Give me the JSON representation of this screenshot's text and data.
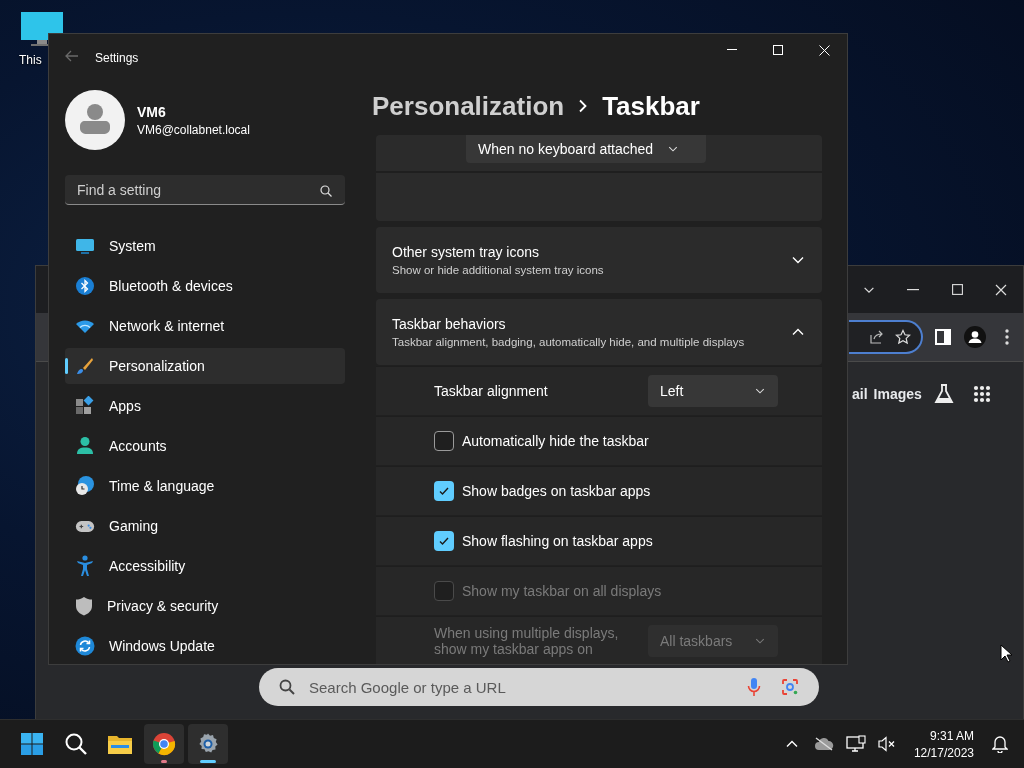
{
  "desktop": {
    "icons": [
      {
        "label": "This"
      }
    ]
  },
  "browser_window": {
    "links": [
      {
        "label": "ail"
      },
      {
        "label": "Images"
      }
    ],
    "search": {
      "placeholder": "Search Google or type a URL"
    }
  },
  "settings_window": {
    "title": "Settings",
    "profile": {
      "name": "VM6",
      "email": "VM6@collabnet.local"
    },
    "search": {
      "placeholder": "Find a setting"
    },
    "nav": [
      {
        "label": "System",
        "selected": false
      },
      {
        "label": "Bluetooth & devices",
        "selected": false
      },
      {
        "label": "Network & internet",
        "selected": false
      },
      {
        "label": "Personalization",
        "selected": true
      },
      {
        "label": "Apps",
        "selected": false
      },
      {
        "label": "Accounts",
        "selected": false
      },
      {
        "label": "Time & language",
        "selected": false
      },
      {
        "label": "Gaming",
        "selected": false
      },
      {
        "label": "Accessibility",
        "selected": false
      },
      {
        "label": "Privacy & security",
        "selected": false
      },
      {
        "label": "Windows Update",
        "selected": false
      }
    ],
    "breadcrumb": [
      "Personalization",
      "Taskbar"
    ],
    "partial_card": {
      "value": "When no keyboard attached"
    },
    "cards": [
      {
        "title": "Other system tray icons",
        "subtitle": "Show or hide additional system tray icons",
        "expanded": false
      },
      {
        "title": "Taskbar behaviors",
        "subtitle": "Taskbar alignment, badging, automatically hide, and multiple displays",
        "expanded": true,
        "rows": [
          {
            "kind": "select",
            "label": "Taskbar alignment",
            "value": "Left",
            "disabled": false
          },
          {
            "kind": "checkbox",
            "label": "Automatically hide the taskbar",
            "checked": false,
            "disabled": false
          },
          {
            "kind": "checkbox",
            "label": "Show badges on taskbar apps",
            "checked": true,
            "disabled": false
          },
          {
            "kind": "checkbox",
            "label": "Show flashing on taskbar apps",
            "checked": true,
            "disabled": false
          },
          {
            "kind": "checkbox",
            "label": "Show my taskbar on all displays",
            "checked": false,
            "disabled": true
          },
          {
            "kind": "select",
            "label": "When using multiple displays, show my taskbar apps on",
            "value": "All taskbars",
            "disabled": true
          }
        ]
      }
    ]
  },
  "taskbar": {
    "apps": [
      {
        "kind": "start",
        "running": false,
        "focused": false
      },
      {
        "kind": "search",
        "running": false,
        "focused": false
      },
      {
        "kind": "files",
        "running": false,
        "focused": false
      },
      {
        "kind": "browser",
        "running": true,
        "focused": false
      },
      {
        "kind": "settings",
        "running": true,
        "focused": true
      }
    ],
    "time": "9:31 AM",
    "date": "12/17/2023"
  }
}
